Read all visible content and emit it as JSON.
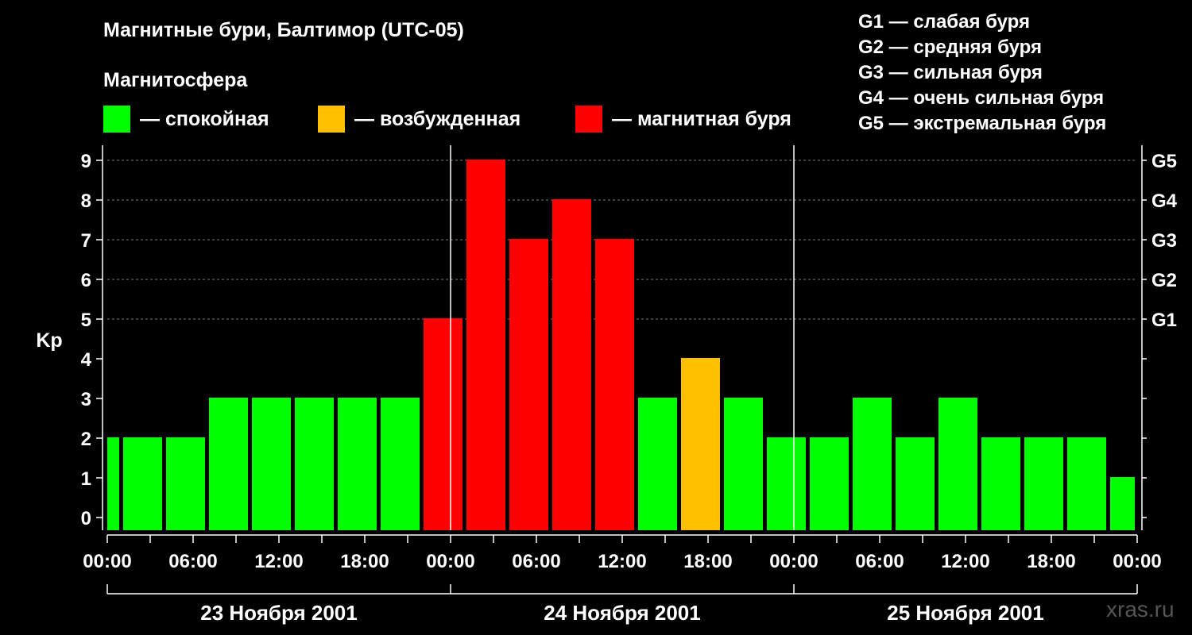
{
  "header": {
    "title": "Магнитные бури, Балтимор (UTC-05)",
    "subtitle": "Магнитосфера"
  },
  "legend": [
    {
      "label": "— спокойная",
      "color": "#00ff00"
    },
    {
      "label": "— возбужденная",
      "color": "#ffc000"
    },
    {
      "label": "— магнитная буря",
      "color": "#ff0000"
    }
  ],
  "storm_scale": [
    "G1 — слабая буря",
    "G2 — средняя буря",
    "G3 — сильная буря",
    "G4 — очень сильная буря",
    "G5 — экстремальная буря"
  ],
  "watermark": "xras.ru",
  "chart_data": {
    "type": "bar",
    "ylabel": "Kp",
    "ylim": [
      0,
      9
    ],
    "y_ticks": [
      "0",
      "1",
      "2",
      "3",
      "4",
      "5",
      "6",
      "7",
      "8",
      "9"
    ],
    "right_axis_labels": [
      {
        "kp": 5,
        "label": "G1"
      },
      {
        "kp": 6,
        "label": "G2"
      },
      {
        "kp": 7,
        "label": "G3"
      },
      {
        "kp": 8,
        "label": "G4"
      },
      {
        "kp": 9,
        "label": "G5"
      }
    ],
    "x_tick_labels": [
      "00:00",
      "06:00",
      "12:00",
      "18:00",
      "00:00",
      "06:00",
      "12:00",
      "18:00",
      "00:00",
      "06:00",
      "12:00",
      "18:00",
      "00:00"
    ],
    "days": [
      "23 Ноября 2001",
      "24 Ноября 2001",
      "25 Ноября 2001"
    ],
    "interval_hours": 3,
    "first_interval_partial": true,
    "values": [
      2,
      2,
      2,
      3,
      3,
      3,
      3,
      3,
      5,
      9,
      7,
      8,
      7,
      3,
      4,
      3,
      2,
      2,
      3,
      2,
      3,
      2,
      2,
      2,
      1
    ],
    "colors": {
      "quiet": "#00ff00",
      "active": "#ffc000",
      "storm": "#ff0000"
    },
    "grid": true
  }
}
